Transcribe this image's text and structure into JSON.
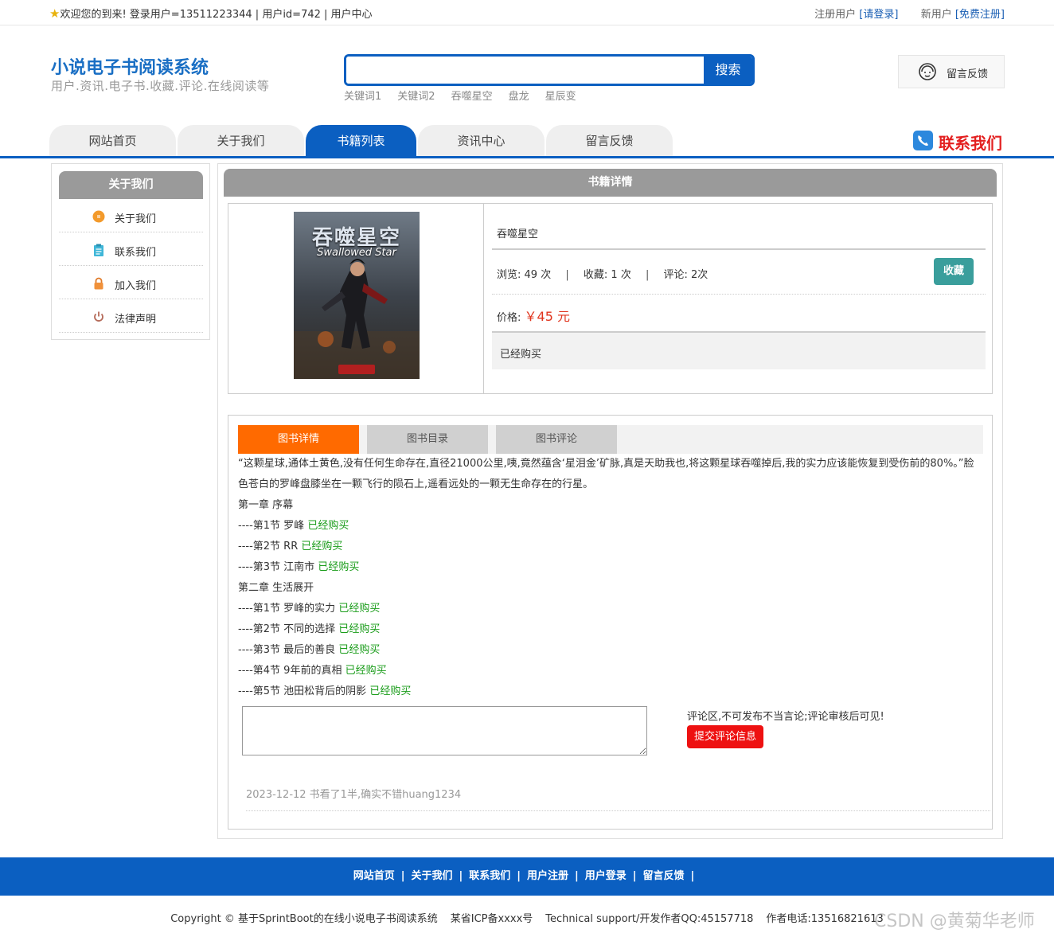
{
  "topbar": {
    "welcome": "欢迎您的到来!  登录用户=13511223344 | 用户id=742 | 用户中心",
    "register_user_label": "注册用户",
    "login_link": "[请登录]",
    "new_user_label": "新用户",
    "free_register_link": "[免费注册]"
  },
  "header": {
    "site_title": "小说电子书阅读系统",
    "site_subtitle": "用户.资讯.电子书.收藏.评论.在线阅读等",
    "search_placeholder": "",
    "search_button": "搜索",
    "keywords": [
      "关键词1",
      "关键词2",
      "吞噬星空",
      "盘龙",
      "星辰变"
    ],
    "feedback_label": "留言反馈"
  },
  "nav": {
    "tabs": [
      "网站首页",
      "关于我们",
      "书籍列表",
      "资讯中心",
      "留言反馈"
    ],
    "active_index": 2,
    "contact_label": "联系我们"
  },
  "sidebar": {
    "title": "关于我们",
    "items": [
      {
        "label": "关于我们",
        "icon": "info-circle-icon"
      },
      {
        "label": "联系我们",
        "icon": "clipboard-icon"
      },
      {
        "label": "加入我们",
        "icon": "lock-icon"
      },
      {
        "label": "法律声明",
        "icon": "power-icon"
      }
    ]
  },
  "book": {
    "section_title": "书籍详情",
    "cover_title": "吞噬星空",
    "cover_subtitle": "Swallowed Star",
    "name": "吞噬星空",
    "views_label": "浏览:",
    "views_value": "49 次",
    "favorites_label": "收藏:",
    "favorites_value": "1 次",
    "comments_label": "评论:",
    "comments_value": "2次",
    "favorite_button": "收藏",
    "price_label": "价格:",
    "price_value": "￥45 元",
    "purchase_status": "已经购买"
  },
  "tabs": {
    "items": [
      "图书详情",
      "图书目录",
      "图书评论"
    ],
    "active_index": 0
  },
  "content": {
    "intro": "“这颗星球,通体土黄色,没有任何生命存在,直径21000公里,咦,竟然蕴含‘星泪金’矿脉,真是天助我也,将这颗星球吞噬掉后,我的实力应该能恢复到受伤前的80%。”脸色苍白的罗峰盘膝坐在一颗飞行的陨石上,遥看远处的一颗无生命存在的行星。",
    "chapters": [
      {
        "title": "第一章 序幕",
        "sections": [
          {
            "title": "----第1节 罗峰",
            "status": "已经购买"
          },
          {
            "title": "----第2节 RR",
            "status": "已经购买"
          },
          {
            "title": "----第3节 江南市",
            "status": "已经购买"
          }
        ]
      },
      {
        "title": "第二章 生活展开",
        "sections": [
          {
            "title": "----第1节 罗峰的实力",
            "status": "已经购买"
          },
          {
            "title": "----第2节 不同的选择",
            "status": "已经购买"
          },
          {
            "title": "----第3节 最后的善良",
            "status": "已经购买"
          },
          {
            "title": "----第4节 9年前的真相",
            "status": "已经购买"
          },
          {
            "title": "----第5节 池田松背后的阴影",
            "status": "已经购买"
          }
        ]
      }
    ]
  },
  "comment": {
    "textarea_value": "",
    "note": "评论区,不可发布不当言论;评论审核后可见!",
    "submit_button": "提交评论信息",
    "review_text": "2023-12-12 书看了1半,确实不错huang1234"
  },
  "footer": {
    "links": [
      "网站首页",
      "关于我们",
      "联系我们",
      "用户注册",
      "用户登录",
      "留言反馈"
    ],
    "copyright": "Copyright © 基于SprintBoot的在线小说电子书阅读系统",
    "icp": "某省ICP备xxxx号",
    "support": "Technical support/开发作者QQ:45157718",
    "phone": "作者电话:13516821613",
    "watermark": "CSDN @黄菊华老师"
  },
  "colors": {
    "brand_blue": "#0b5fc1",
    "tab_orange": "#ff6a00",
    "price_red": "#e0341d",
    "green_status": "#1a9c1a",
    "favorite_teal": "#3a9e9c",
    "submit_red": "#ee1111"
  }
}
